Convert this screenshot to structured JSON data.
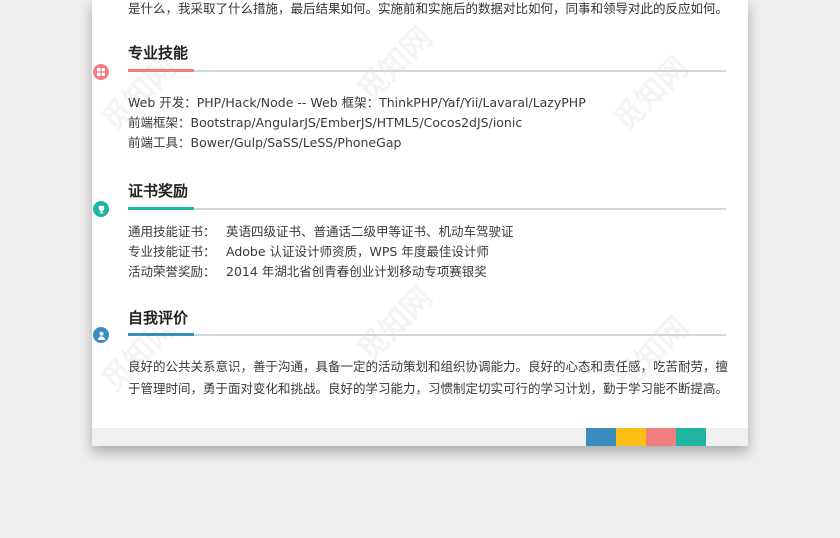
{
  "intro_tail": "是什么，我采取了什么措施，最后结果如何。实施前和实施后的数据对比如何，同事和领导对此的反应如何。",
  "skills": {
    "title": "专业技能",
    "lines": [
      "Web 开发：PHP/Hack/Node      --      Web 框架：ThinkPHP/Yaf/Yii/Lavaral/LazyPHP",
      "前端框架：Bootstrap/AngularJS/EmberJS/HTML5/Cocos2dJS/ionic",
      "前端工具：Bower/Gulp/SaSS/LeSS/PhoneGap"
    ]
  },
  "awards": {
    "title": "证书奖励",
    "rows": [
      {
        "label": "通用技能证书：",
        "value": "英语四级证书、普通话二级甲等证书、机动车驾驶证"
      },
      {
        "label": "专业技能证书：",
        "value": "Adobe 认证设计师资质，WPS 年度最佳设计师"
      },
      {
        "label": "活动荣誉奖励：",
        "value": "2014 年湖北省创青春创业计划移动专项赛银奖"
      }
    ]
  },
  "self_eval": {
    "title": "自我评价",
    "text": "良好的公共关系意识，善于沟通，具备一定的活动策划和组织协调能力。良好的心态和责任感，吃苦耐劳，擅于管理时间，勇于面对变化和挑战。良好的学习能力，习惯制定切实可行的学习计划，勤于学习能不断提高。"
  },
  "watermark": "觅知网",
  "colors": {
    "blue": "#3a8dbf",
    "yellow": "#fdbf16",
    "pink": "#f08080",
    "teal": "#1fb5a0",
    "skills_accent": "#f17f7f",
    "awards_accent": "#1fb5a0",
    "eval_accent": "#3a8dbf"
  },
  "icons": {
    "skills": "grid-icon",
    "awards": "trophy-icon",
    "eval": "person-icon"
  }
}
